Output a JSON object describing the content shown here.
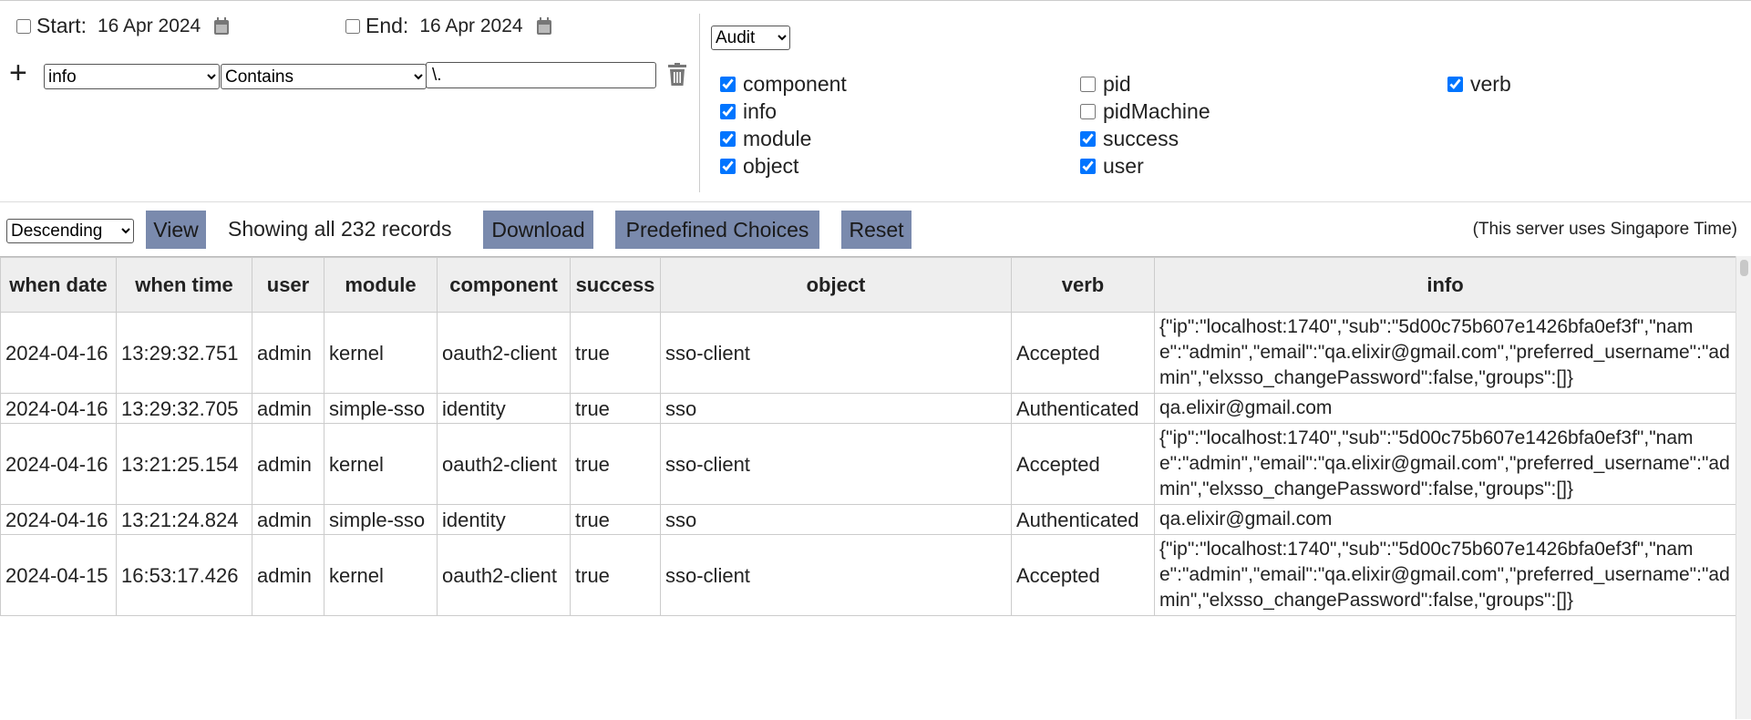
{
  "filters": {
    "start_label": "Start:",
    "start_date": "16 Apr 2024",
    "end_label": "End:",
    "end_date": "16 Apr 2024",
    "add_icon": "+",
    "field": "info",
    "operator": "Contains",
    "value": "\\."
  },
  "type_select": "Audit",
  "columns": [
    {
      "label": "component",
      "checked": true
    },
    {
      "label": "info",
      "checked": true
    },
    {
      "label": "module",
      "checked": true
    },
    {
      "label": "object",
      "checked": true
    },
    {
      "label": "pid",
      "checked": false
    },
    {
      "label": "pidMachine",
      "checked": false
    },
    {
      "label": "success",
      "checked": true
    },
    {
      "label": "user",
      "checked": true
    },
    {
      "label": "verb",
      "checked": true
    }
  ],
  "toolbar": {
    "sort": "Descending",
    "view_label": "View",
    "records_text": "Showing all 232 records",
    "download_label": "Download",
    "predefined_label": "Predefined Choices",
    "reset_label": "Reset",
    "server_note": "(This server uses Singapore Time)"
  },
  "table": {
    "headers": [
      "when date",
      "when time",
      "user",
      "module",
      "component",
      "success",
      "object",
      "verb",
      "info"
    ],
    "rows": [
      [
        "2024-04-16",
        "13:29:32.751",
        "admin",
        "kernel",
        "oauth2-client",
        "true",
        "sso-client",
        "Accepted",
        "{\"ip\":\"localhost:1740\",\"sub\":\"5d00c75b607e1426bfa0ef3f\",\"name\":\"admin\",\"email\":\"qa.elixir@gmail.com\",\"preferred_username\":\"admin\",\"elxsso_changePassword\":false,\"groups\":[]}"
      ],
      [
        "2024-04-16",
        "13:29:32.705",
        "admin",
        "simple-sso",
        "identity",
        "true",
        "sso",
        "Authenticated",
        "qa.elixir@gmail.com"
      ],
      [
        "2024-04-16",
        "13:21:25.154",
        "admin",
        "kernel",
        "oauth2-client",
        "true",
        "sso-client",
        "Accepted",
        "{\"ip\":\"localhost:1740\",\"sub\":\"5d00c75b607e1426bfa0ef3f\",\"name\":\"admin\",\"email\":\"qa.elixir@gmail.com\",\"preferred_username\":\"admin\",\"elxsso_changePassword\":false,\"groups\":[]}"
      ],
      [
        "2024-04-16",
        "13:21:24.824",
        "admin",
        "simple-sso",
        "identity",
        "true",
        "sso",
        "Authenticated",
        "qa.elixir@gmail.com"
      ],
      [
        "2024-04-15",
        "16:53:17.426",
        "admin",
        "kernel",
        "oauth2-client",
        "true",
        "sso-client",
        "Accepted",
        "{\"ip\":\"localhost:1740\",\"sub\":\"5d00c75b607e1426bfa0ef3f\",\"name\":\"admin\",\"email\":\"qa.elixir@gmail.com\",\"preferred_username\":\"admin\",\"elxsso_changePassword\":false,\"groups\":[]}"
      ]
    ]
  }
}
